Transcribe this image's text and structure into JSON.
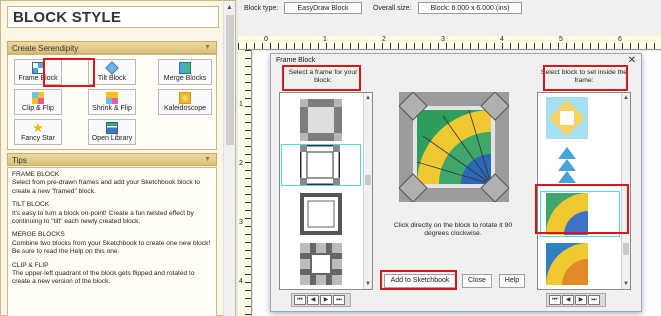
{
  "left_panel": {
    "title": "BLOCK STYLE",
    "serendipity_header": "Create Serendipity",
    "tools": [
      {
        "label": "Frame Block",
        "icon": "frame-block-icon"
      },
      {
        "label": "Tilt Block",
        "icon": "tilt-block-icon"
      },
      {
        "label": "Merge Blocks",
        "icon": "merge-blocks-icon"
      },
      {
        "label": "Clip & Flip",
        "icon": "clip-flip-icon"
      },
      {
        "label": "Shrink & Flip",
        "icon": "shrink-flip-icon"
      },
      {
        "label": "Kaleidoscope",
        "icon": "kaleidoscope-icon"
      },
      {
        "label": "Fancy Star",
        "icon": "fancy-star-icon"
      },
      {
        "label": "Open Library",
        "icon": "open-library-icon"
      }
    ],
    "tips_header": "Tips",
    "tips": [
      {
        "heading": "FRAME BLOCK",
        "body": "Select from pre-drawn frames and add your Sketchbook block to create a new \"framed\" block."
      },
      {
        "heading": "TILT BLOCK",
        "body": "It's easy to turn a block on-point! Create a fun twisted effect by continuing to \"tilt\" each newly created block."
      },
      {
        "heading": "MERGE BLOCKS",
        "body": "Combine two blocks from your Sketchbook to create one new block! Be sure to read the Help on this one."
      },
      {
        "heading": "CLIP & FLIP",
        "body": "The upper-left quadrant of the block gets flipped and rotated to create a new version of the block."
      }
    ]
  },
  "toolbar": {
    "block_type_label": "Block type:",
    "block_type_value": "EasyDraw Block",
    "overall_size_label": "Overall size:",
    "overall_size_value": "Block: 6.000 x 6.000 (ins)"
  },
  "rulers": {
    "h": [
      "0",
      "1",
      "2",
      "3",
      "4",
      "5",
      "6"
    ],
    "v": [
      "1",
      "2",
      "3",
      "4"
    ]
  },
  "dialog": {
    "title": "Frame Block",
    "frame_caption": "Select a frame for your block:",
    "block_caption": "Select block to set inside the frame:",
    "instruction": "Click directly on the block to rotate it 90 degrees clockwise.",
    "add_button": "Add to Sketchbook",
    "close_button": "Close",
    "help_button": "Help",
    "nav": [
      "⏮",
      "◀",
      "▶",
      "⏭"
    ]
  },
  "colors": {
    "highlight": "#d8161b",
    "panel_bg": "#fdf6e6",
    "header_gold": "#dcc07a",
    "selection": "#56d4ea"
  }
}
